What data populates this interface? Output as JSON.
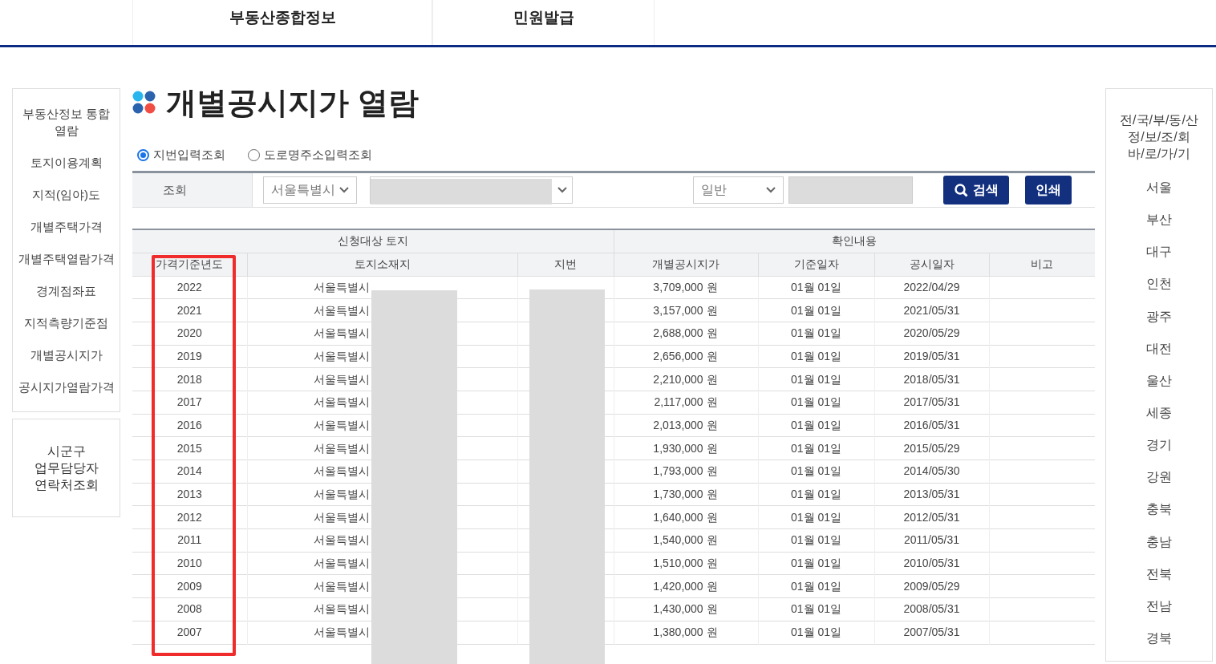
{
  "top_nav": [
    {
      "label": "부동산종합정보"
    },
    {
      "label": "민원발급"
    }
  ],
  "left_menu": [
    {
      "label": "부동산정보 통합 열람"
    },
    {
      "label": "토지이용계획"
    },
    {
      "label": "지적(임야)도"
    },
    {
      "label": "개별주택가격"
    },
    {
      "label": "개별주택열람가격"
    },
    {
      "label": "경계점좌표"
    },
    {
      "label": "지적측량기준점"
    },
    {
      "label": "개별공시지가"
    },
    {
      "label": "공시지가열람가격"
    }
  ],
  "contact_box": {
    "label": "시군구 업무담당자 연락처조회"
  },
  "title": "개별공시지가 열람",
  "search_modes": [
    {
      "label": "지번입력조회",
      "selected": true
    },
    {
      "label": "도로명주소입력조회",
      "selected": false
    }
  ],
  "search": {
    "label": "조회",
    "city": "서울특별시",
    "type": "일반",
    "buttons": [
      {
        "kind": "search",
        "label": "검색"
      },
      {
        "kind": "print",
        "label": "인쇄"
      }
    ]
  },
  "table": {
    "groups": [
      {
        "label": "신청대상 토지"
      },
      {
        "label": "확인내용"
      }
    ],
    "columns": [
      "가격기준년도",
      "토지소재지",
      "지번",
      "개별공시지가",
      "기준일자",
      "공시일자",
      "비고"
    ],
    "rows": [
      {
        "year": "2022",
        "address": "서울특별시",
        "price": "3,709,000 원",
        "base_date": "01월 01일",
        "notice_date": "2022/04/29"
      },
      {
        "year": "2021",
        "address": "서울특별시",
        "price": "3,157,000 원",
        "base_date": "01월 01일",
        "notice_date": "2021/05/31"
      },
      {
        "year": "2020",
        "address": "서울특별시",
        "price": "2,688,000 원",
        "base_date": "01월 01일",
        "notice_date": "2020/05/29"
      },
      {
        "year": "2019",
        "address": "서울특별시",
        "price": "2,656,000 원",
        "base_date": "01월 01일",
        "notice_date": "2019/05/31"
      },
      {
        "year": "2018",
        "address": "서울특별시",
        "price": "2,210,000 원",
        "base_date": "01월 01일",
        "notice_date": "2018/05/31"
      },
      {
        "year": "2017",
        "address": "서울특별시",
        "price": "2,117,000 원",
        "base_date": "01월 01일",
        "notice_date": "2017/05/31"
      },
      {
        "year": "2016",
        "address": "서울특별시",
        "price": "2,013,000 원",
        "base_date": "01월 01일",
        "notice_date": "2016/05/31"
      },
      {
        "year": "2015",
        "address": "서울특별시",
        "price": "1,930,000 원",
        "base_date": "01월 01일",
        "notice_date": "2015/05/29"
      },
      {
        "year": "2014",
        "address": "서울특별시",
        "price": "1,793,000 원",
        "base_date": "01월 01일",
        "notice_date": "2014/05/30"
      },
      {
        "year": "2013",
        "address": "서울특별시",
        "price": "1,730,000 원",
        "base_date": "01월 01일",
        "notice_date": "2013/05/31"
      },
      {
        "year": "2012",
        "address": "서울특별시",
        "price": "1,640,000 원",
        "base_date": "01월 01일",
        "notice_date": "2012/05/31"
      },
      {
        "year": "2011",
        "address": "서울특별시",
        "price": "1,540,000 원",
        "base_date": "01월 01일",
        "notice_date": "2011/05/31"
      },
      {
        "year": "2010",
        "address": "서울특별시",
        "price": "1,510,000 원",
        "base_date": "01월 01일",
        "notice_date": "2010/05/31"
      },
      {
        "year": "2009",
        "address": "서울특별시",
        "price": "1,420,000 원",
        "base_date": "01월 01일",
        "notice_date": "2009/05/29"
      },
      {
        "year": "2008",
        "address": "서울특별시",
        "price": "1,430,000 원",
        "base_date": "01월 01일",
        "notice_date": "2008/05/31"
      },
      {
        "year": "2007",
        "address": "서울특별시",
        "price": "1,380,000 원",
        "base_date": "01월 01일",
        "notice_date": "2007/05/31"
      }
    ]
  },
  "right_menu": {
    "title": "전/국/부/동/산 정/보/조/회 바/로/가/기",
    "regions": [
      "서울",
      "부산",
      "대구",
      "인천",
      "광주",
      "대전",
      "울산",
      "세종",
      "경기",
      "강원",
      "충북",
      "충남",
      "전북",
      "전남",
      "경북"
    ]
  }
}
